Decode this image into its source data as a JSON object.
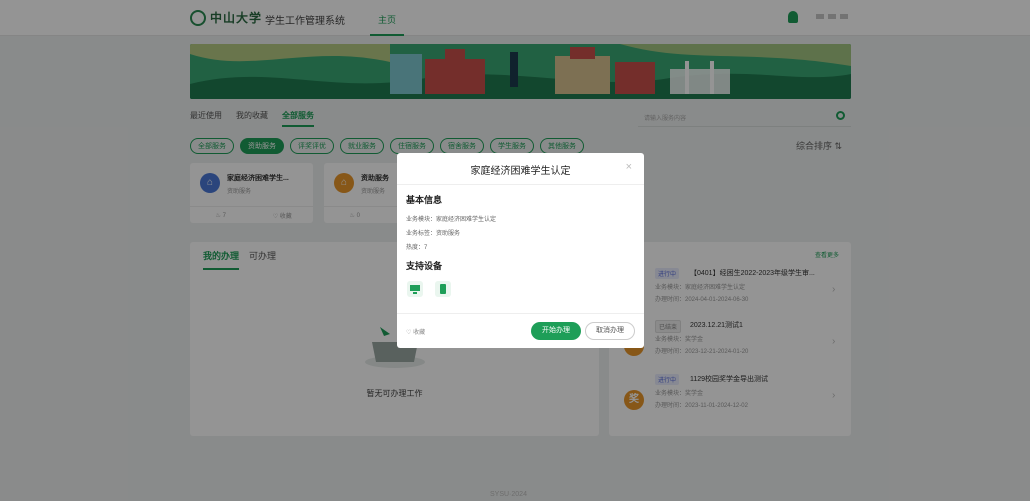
{
  "header": {
    "logo_text": "中山大学",
    "system_title": "学生工作管理系统",
    "nav_tab": "主页"
  },
  "services": {
    "tabs": [
      "最近使用",
      "我的收藏",
      "全部服务"
    ],
    "active_tab": "全部服务",
    "search_placeholder": "请输入服务内容",
    "chips": [
      "全部服务",
      "资助服务",
      "评奖评优",
      "就业服务",
      "住宿服务",
      "宿舍服务",
      "学生服务",
      "其他服务"
    ],
    "active_chip": "资助服务",
    "sort_label": "综合排序",
    "cards": [
      {
        "title": "家庭经济困难学生...",
        "subtitle": "资助服务",
        "heat": "7",
        "fav": "收藏"
      },
      {
        "title": "资助服务",
        "subtitle": "资助服务",
        "heat": "0",
        "fav": ""
      }
    ]
  },
  "my_handle": {
    "tabs": [
      "我的办理",
      "可办理"
    ],
    "empty_text": "暂无可办理工作"
  },
  "todo": {
    "more_label": "查看更多",
    "items": [
      {
        "status": "进行中",
        "title": "【0401】经困生2022-2023年级学生审...",
        "line1": "业务模块：家庭经济困难学生认定",
        "line2": "办理时间：2024-04-01-2024-06-30",
        "avatar": ""
      },
      {
        "status": "已结束",
        "title": "2023.12.21测试1",
        "line1": "业务模块：奖学金",
        "line2": "办理时间：2023-12-21-2024-01-20",
        "avatar": ""
      },
      {
        "status": "进行中",
        "title": "1129校园奖学金导出测试",
        "line1": "业务模块：奖学金",
        "line2": "办理时间：2023-11-01-2024-12-02",
        "avatar": "奖"
      }
    ]
  },
  "modal": {
    "title": "家庭经济困难学生认定",
    "basic_info_heading": "基本信息",
    "module_line": "业务模块：家庭经济困难学生认定",
    "tag_line": "业务标签：资助服务",
    "heat_line": "热度：7",
    "devices_heading": "支持设备",
    "devices": [
      "desktop-icon",
      "mobile-icon"
    ],
    "favorite_label": "收藏",
    "start_button": "开始办理",
    "cancel_button": "取消办理"
  },
  "footer": {
    "mark": "SYSU·2024"
  },
  "colors": {
    "accent": "#1e9e58",
    "overlay": "rgba(0,0,0,0.42)"
  }
}
